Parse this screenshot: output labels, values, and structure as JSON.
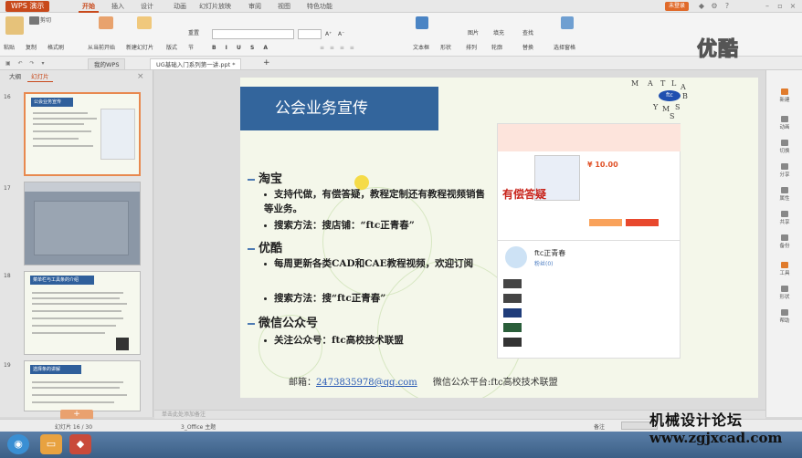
{
  "titlebar": {
    "app_name": "WPS 演示",
    "tabs": [
      "开始",
      "插入",
      "设计",
      "动画",
      "幻灯片放映",
      "审阅",
      "视图",
      "特色功能"
    ],
    "active_tab": "开始",
    "login": "未登录"
  },
  "ribbon": {
    "paste": "粘贴",
    "cut": "剪切",
    "copy": "复制",
    "format_painter": "格式刷",
    "from_start": "从当前开始",
    "new_slide": "新建幻灯片",
    "layout": "版式",
    "reset": "重置",
    "section": "节",
    "textbox": "文本框",
    "shape": "形状",
    "arrange": "排列",
    "outline": "轮廓",
    "picture": "图片",
    "fill": "填充",
    "find": "查找",
    "replace": "替换",
    "select_pane": "选择窗格",
    "font_size_a": "A⁺",
    "font_size_b": "A⁻"
  },
  "docbar": {
    "tabs": [
      {
        "label": "我的WPS"
      },
      {
        "label": "UG基础入门系列第一讲.ppt *"
      }
    ],
    "add_tab": "+"
  },
  "left_panel": {
    "tabs": [
      "大纲",
      "幻灯片"
    ],
    "active_tab": "幻灯片",
    "slides": [
      {
        "num": "16",
        "title": "公会业务宣传"
      },
      {
        "num": "17",
        "title": ""
      },
      {
        "num": "18",
        "title": "菜单栏与工具条的介绍"
      },
      {
        "num": "19",
        "title": "选择条的讲解"
      }
    ],
    "add_button": "+"
  },
  "slide": {
    "title": "公会业务宣传",
    "sections": [
      {
        "heading": "淘宝",
        "bullets": [
          "支持代做，有偿答疑，教程定制还有教程视频销售等业务。",
          "搜索方法：搜店铺：“ftc正青春”"
        ]
      },
      {
        "heading": "优酷",
        "bullets": [
          "每周更新各类CAD和CAE教程视频，欢迎订阅",
          "搜索方法：搜“ftc正青春”"
        ]
      },
      {
        "heading": "微信公众号",
        "bullets": [
          "关注公众号：ftc高校技术联盟"
        ]
      }
    ],
    "email_label": "邮箱：",
    "email": "2473835978@qq.com",
    "wechat_platform": "微信公众平台:ftc高校技术联盟",
    "paid_qa": "有偿答疑",
    "shop_price": "¥ 10.00",
    "profile_name": "ftc正青春",
    "profile_sub": "粉丝(0)",
    "mlab_letters": [
      "M",
      "A",
      "T",
      "L",
      "A",
      "B",
      "S",
      "Y",
      "M",
      "S"
    ]
  },
  "right_sidebar": {
    "items": [
      "新建",
      "动画",
      "切换",
      "分享",
      "属性",
      "共享",
      "备份",
      "工具",
      "形状",
      "帮助"
    ]
  },
  "notes_placeholder": "单击此处添加备注",
  "status": {
    "slide_count": "幻灯片 16 / 30",
    "theme": "3_Office 主题",
    "notes": "备注"
  },
  "watermarks": {
    "youku": "优酷",
    "forum": "机械设计论坛",
    "url": "www.zgjxcad.com"
  },
  "colors": {
    "accent": "#c8491b",
    "slide_title_bg": "#33659c",
    "slide_bg": "#f4f7ea",
    "link": "#2a5bb5"
  }
}
